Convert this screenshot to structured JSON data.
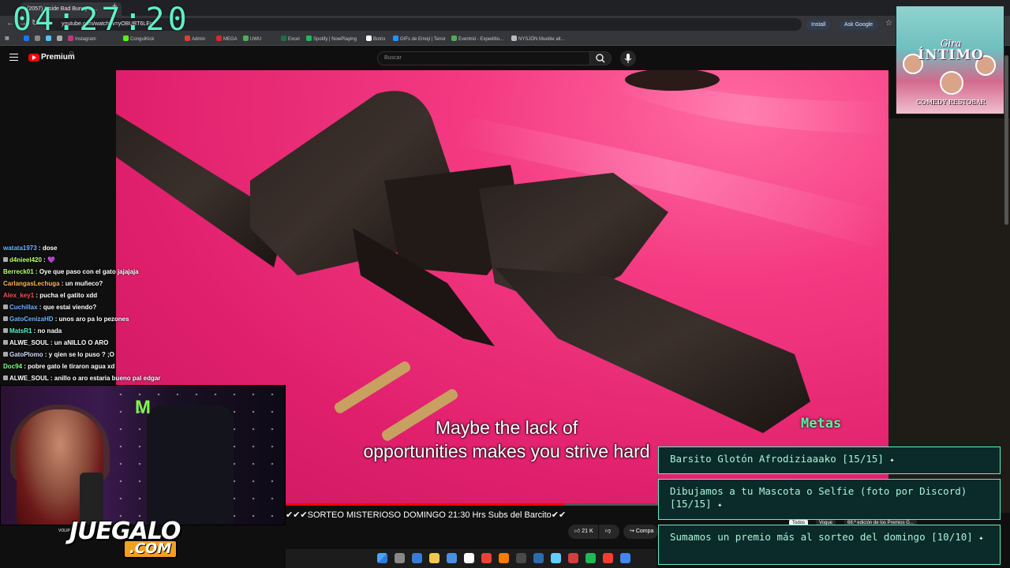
{
  "browser": {
    "tab_title": "(2057) Inside Bad Bunny's ...",
    "new_tab": "+",
    "url": "youtube.com/watch?v=yOBUBT6LEg",
    "install_label": "Install",
    "ask_google_label": "Ask Google",
    "bookmarks": [
      {
        "label": "Instagram",
        "color": "#c13584"
      },
      {
        "label": "ConguiKick",
        "color": "#53fc18"
      },
      {
        "label": "Admin",
        "color": "#e53935"
      },
      {
        "label": "MEGA",
        "color": "#d9272e"
      },
      {
        "label": "UWU",
        "color": "#4caf50"
      },
      {
        "label": "Excel",
        "color": "#1d6f42"
      },
      {
        "label": "Spotify | NowPlaying",
        "color": "#1db954"
      },
      {
        "label": "Botrix",
        "color": "#ffffff"
      },
      {
        "label": "GIFs de Emoji | Tenor",
        "color": "#2196f3"
      },
      {
        "label": "Eventrid - Expeditio...",
        "color": "#4caf50"
      },
      {
        "label": "NYSJÖN Mueble alt...",
        "color": "#bbbbbb"
      }
    ]
  },
  "clock": "04:27:20",
  "youtube": {
    "brand": "Premium",
    "region": "CL",
    "search_placeholder": "Buscar"
  },
  "video": {
    "subtitle_line1": "Maybe the lack of",
    "subtitle_line2": "opportunities makes you strive hard",
    "progress_fraction": 0.46
  },
  "overlay": {
    "metas_label": "Metas",
    "goals": [
      {
        "text": "Barsito Glotón Afrodiziaaako [15/15]"
      },
      {
        "text": "Dibujamos a tu Mascota o Selfie (foto por Discord) [15/15]"
      },
      {
        "text": "Sumamos un premio más al sorteo del domingo [10/10]"
      }
    ],
    "ticker": "✔✔✔SORTEO MISTERIOSO DOMINGO 21:30 Hrs Subs del Barcito✔✔",
    "logo_top": "JUEGALO",
    "logo_bottom": ".COM",
    "logo_small": "VOLIP",
    "poster_gira": "Gira",
    "poster_title": "ÍNTIMO",
    "poster_sub": "COMEDY RESTOBAR"
  },
  "chat": [
    {
      "user": "watata1973",
      "msg": "dose",
      "color": "#6bb5ff"
    },
    {
      "user": "d4nieel420",
      "msg": "💜",
      "color": "#b7ff6b"
    },
    {
      "user": "Berreck01",
      "msg": "Oye que paso con el gato jajajaja",
      "color": "#b7ff6b"
    },
    {
      "user": "CarlangasLechuga",
      "msg": "un muñeco?",
      "color": "#ffb347"
    },
    {
      "user": "Alex_key1",
      "msg": "pucha el gatito xdd",
      "color": "#ff4d4d"
    },
    {
      "user": "Cuchillax",
      "msg": "que estai viendo?",
      "color": "#6bb5ff"
    },
    {
      "user": "GatoCenizaHD",
      "msg": "unos aro pa lo pezones",
      "color": "#6bb5ff"
    },
    {
      "user": "MatsR1",
      "msg": "no nada",
      "color": "#5ff0c8"
    },
    {
      "user": "ALWE_SOUL",
      "msg": "un aNILLO O ARO",
      "color": "#ffffff"
    },
    {
      "user": "GatoPlomo",
      "msg": "y qien se lo puso ? ;O",
      "color": "#cfd8ff"
    },
    {
      "user": "Doc94",
      "msg": "pobre gato le tiraron agua xd",
      "color": "#7dff7d"
    },
    {
      "user": "ALWE_SOUL",
      "msg": "anillo o aro estaria bueno pal edgar",
      "color": "#ffffff"
    }
  ],
  "below_video": {
    "likes": "21 K",
    "share_label": "Compa",
    "filter_chips": [
      "Todos",
      "Vogue",
      "68.ª edición de los Premios G..."
    ]
  }
}
